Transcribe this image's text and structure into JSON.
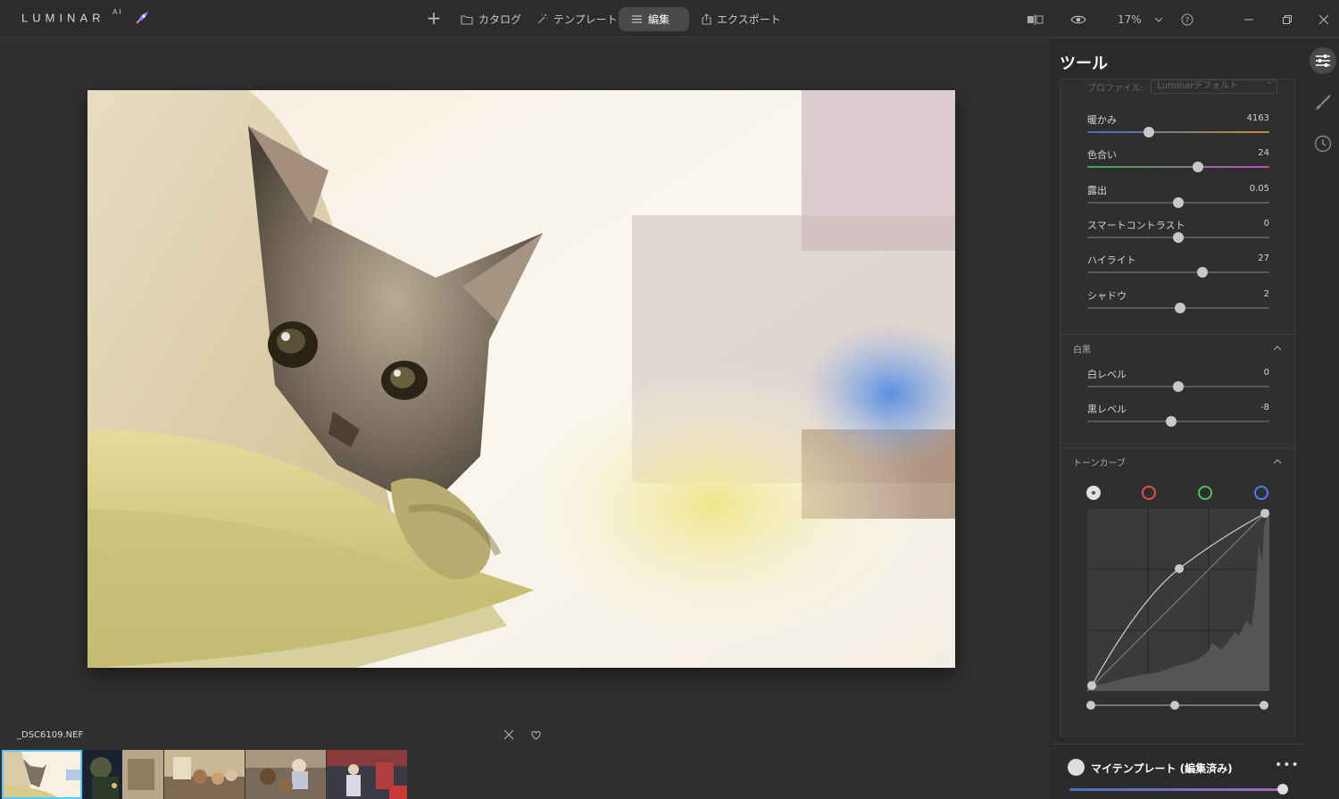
{
  "app": {
    "logo": "LUMINAR",
    "logo_sup": "AI"
  },
  "nav": {
    "catalog": "カタログ",
    "templates": "テンプレート",
    "edit": "編集",
    "export": "エクスポート",
    "zoom": "17%"
  },
  "filmstrip": {
    "filename": "_DSC6109.NEF"
  },
  "tools": {
    "title": "ツール",
    "profile_label": "プロファイル:",
    "profile_value": "Luminarデフォルト",
    "sliders": [
      {
        "label": "暖かみ",
        "value": "4163",
        "position": 0.34,
        "track": "temp"
      },
      {
        "label": "色合い",
        "value": "24",
        "position": 0.61,
        "track": "tint"
      },
      {
        "label": "露出",
        "value": "0.05",
        "position": 0.5,
        "track": "plain"
      },
      {
        "label": "スマートコントラスト",
        "value": "0",
        "position": 0.5,
        "track": "plain"
      },
      {
        "label": "ハイライト",
        "value": "27",
        "position": 0.63,
        "track": "plain"
      },
      {
        "label": "シャドウ",
        "value": "2",
        "position": 0.51,
        "track": "plain"
      }
    ],
    "bw_section": {
      "title": "白黒",
      "sliders": [
        {
          "label": "白レベル",
          "value": "0",
          "position": 0.5
        },
        {
          "label": "黒レベル",
          "value": "-8",
          "position": 0.46
        }
      ]
    },
    "tone_curve": {
      "title": "トーンカーブ",
      "channels": [
        "white",
        "red",
        "green",
        "blue"
      ],
      "points": [
        [
          0,
          0
        ],
        [
          0.5,
          0.7
        ],
        [
          1,
          1
        ]
      ]
    }
  },
  "template": {
    "name": "マイテンプレート (編集済み)",
    "more": "•••",
    "amount": 1.0
  },
  "colors": {
    "accent_blue": "#5ac8ff",
    "channel_white": "#e0e0e0",
    "channel_red": "#e05050",
    "channel_green": "#50c060",
    "channel_blue": "#4a7cff"
  }
}
